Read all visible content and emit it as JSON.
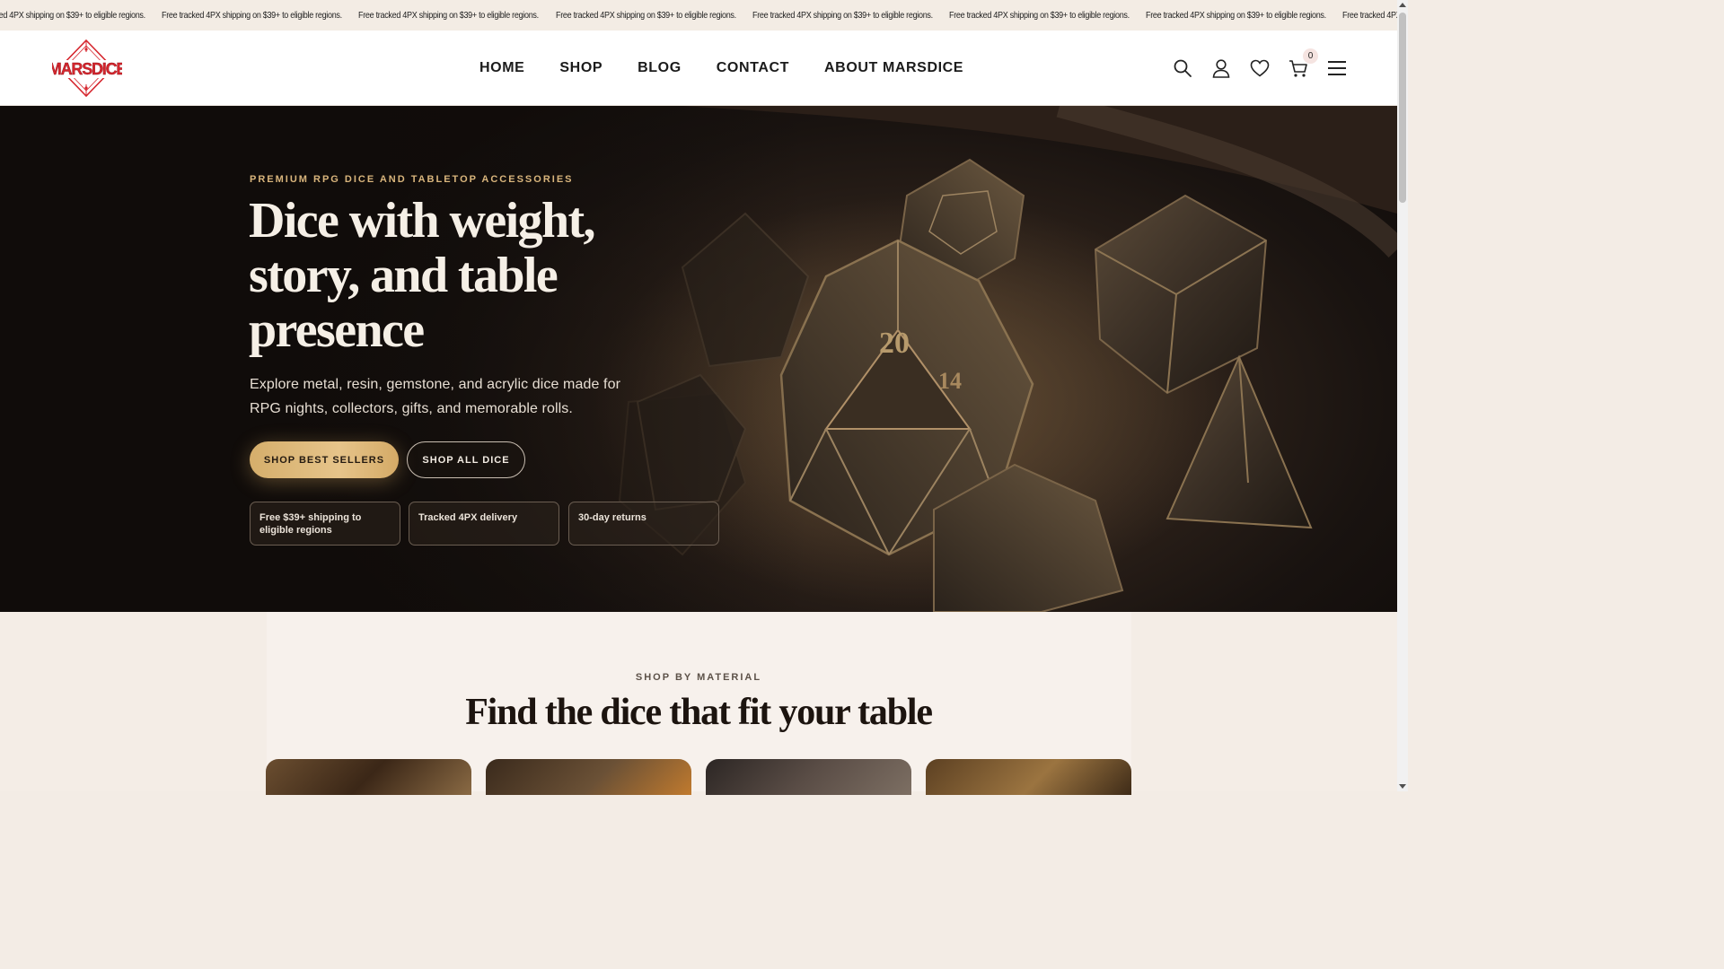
{
  "announcement": {
    "items": [
      "Free tracked 4PX shipping on $39+ to eligible regions.",
      "Free tracked 4PX shipping on $39+ to eligible regions.",
      "Free tracked 4PX shipping on $39+ to eligible regions.",
      "Free tracked 4PX shipping on $39+ to eligible regions.",
      "Free tracked 4PX shipping on $39+ to eligible regions.",
      "Free tracked 4PX shipping on $39+ to eligible regions.",
      "Free tracked 4PX shipping on $39+ to eligible regions.",
      "Free tracked 4PX shipping on $39+ to eligible regions."
    ]
  },
  "header": {
    "logo_text": "MARSDICE",
    "nav": [
      {
        "label": "HOME"
      },
      {
        "label": "SHOP"
      },
      {
        "label": "BLOG"
      },
      {
        "label": "CONTACT"
      },
      {
        "label": "ABOUT MARSDICE"
      }
    ],
    "icons": [
      "search-icon",
      "account-icon",
      "wishlist-icon",
      "cart-icon",
      "menu-icon"
    ],
    "cart_count": "0"
  },
  "hero": {
    "eyebrow": "PREMIUM RPG DICE AND TABLETOP ACCESSORIES",
    "title": "Dice with weight, story, and table presence",
    "subtitle": "Explore metal, resin, gemstone, and acrylic dice made for RPG nights, collectors, gifts, and memorable rolls.",
    "primary_button": "SHOP BEST SELLERS",
    "secondary_button": "SHOP ALL DICE",
    "perks": [
      {
        "label": "Free $39+ shipping to eligible regions"
      },
      {
        "label": "Tracked 4PX delivery"
      },
      {
        "label": "30-day returns"
      }
    ]
  },
  "material_section": {
    "eyebrow": "SHOP BY MATERIAL",
    "title": "Find the dice that fit your table"
  },
  "colors": {
    "accent_gold": "#d9b57c",
    "brand_red": "#d6262e",
    "hero_bg": "#191310",
    "section_bg": "#f4ede6"
  }
}
